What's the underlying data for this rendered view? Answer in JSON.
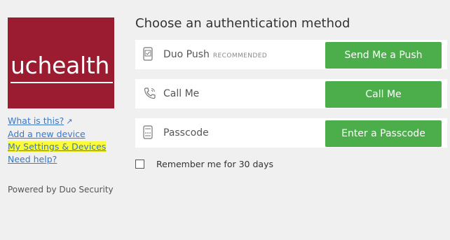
{
  "logo": {
    "text": "uchealth",
    "color": "#9b1b30"
  },
  "links": {
    "what_is_this": "What is this?",
    "add_device": "Add a new device",
    "settings": "My Settings & Devices",
    "need_help": "Need help?"
  },
  "powered_by": "Powered by Duo Security",
  "heading": "Choose an authentication method",
  "methods": [
    {
      "icon": "phone-push-icon",
      "label": "Duo Push",
      "badge": "RECOMMENDED",
      "button": "Send Me a Push"
    },
    {
      "icon": "phone-call-icon",
      "label": "Call Me",
      "button": "Call Me"
    },
    {
      "icon": "passcode-icon",
      "label": "Passcode",
      "button": "Enter a Passcode"
    }
  ],
  "remember_label": "Remember me for 30 days",
  "colors": {
    "button": "#4cae4a",
    "link": "#3b78c4",
    "highlight": "#fbfb3a"
  }
}
